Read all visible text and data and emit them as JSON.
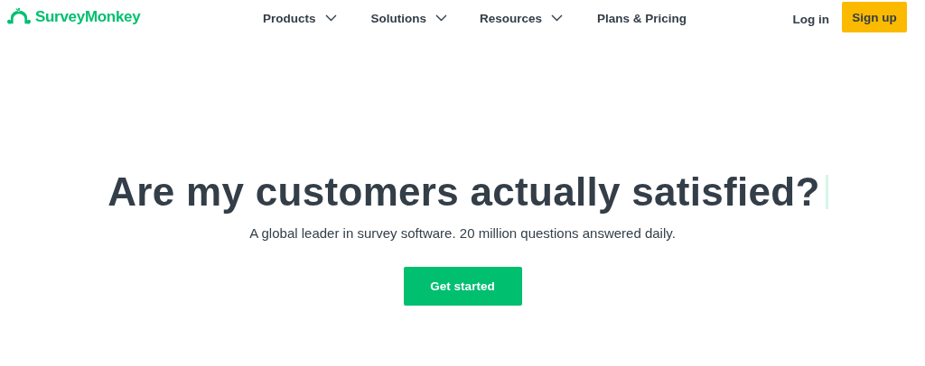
{
  "header": {
    "logo": "SurveyMonkey",
    "nav": [
      {
        "label": "Products",
        "has_menu": true
      },
      {
        "label": "Solutions",
        "has_menu": true
      },
      {
        "label": "Resources",
        "has_menu": true
      },
      {
        "label": "Plans & Pricing",
        "has_menu": false
      }
    ],
    "login": "Log in",
    "signup": "Sign up"
  },
  "hero": {
    "headline": "Are my customers actually satisfied?",
    "subtitle": "A global leader in survey software. 20 million questions answered daily.",
    "cta": "Get started"
  }
}
